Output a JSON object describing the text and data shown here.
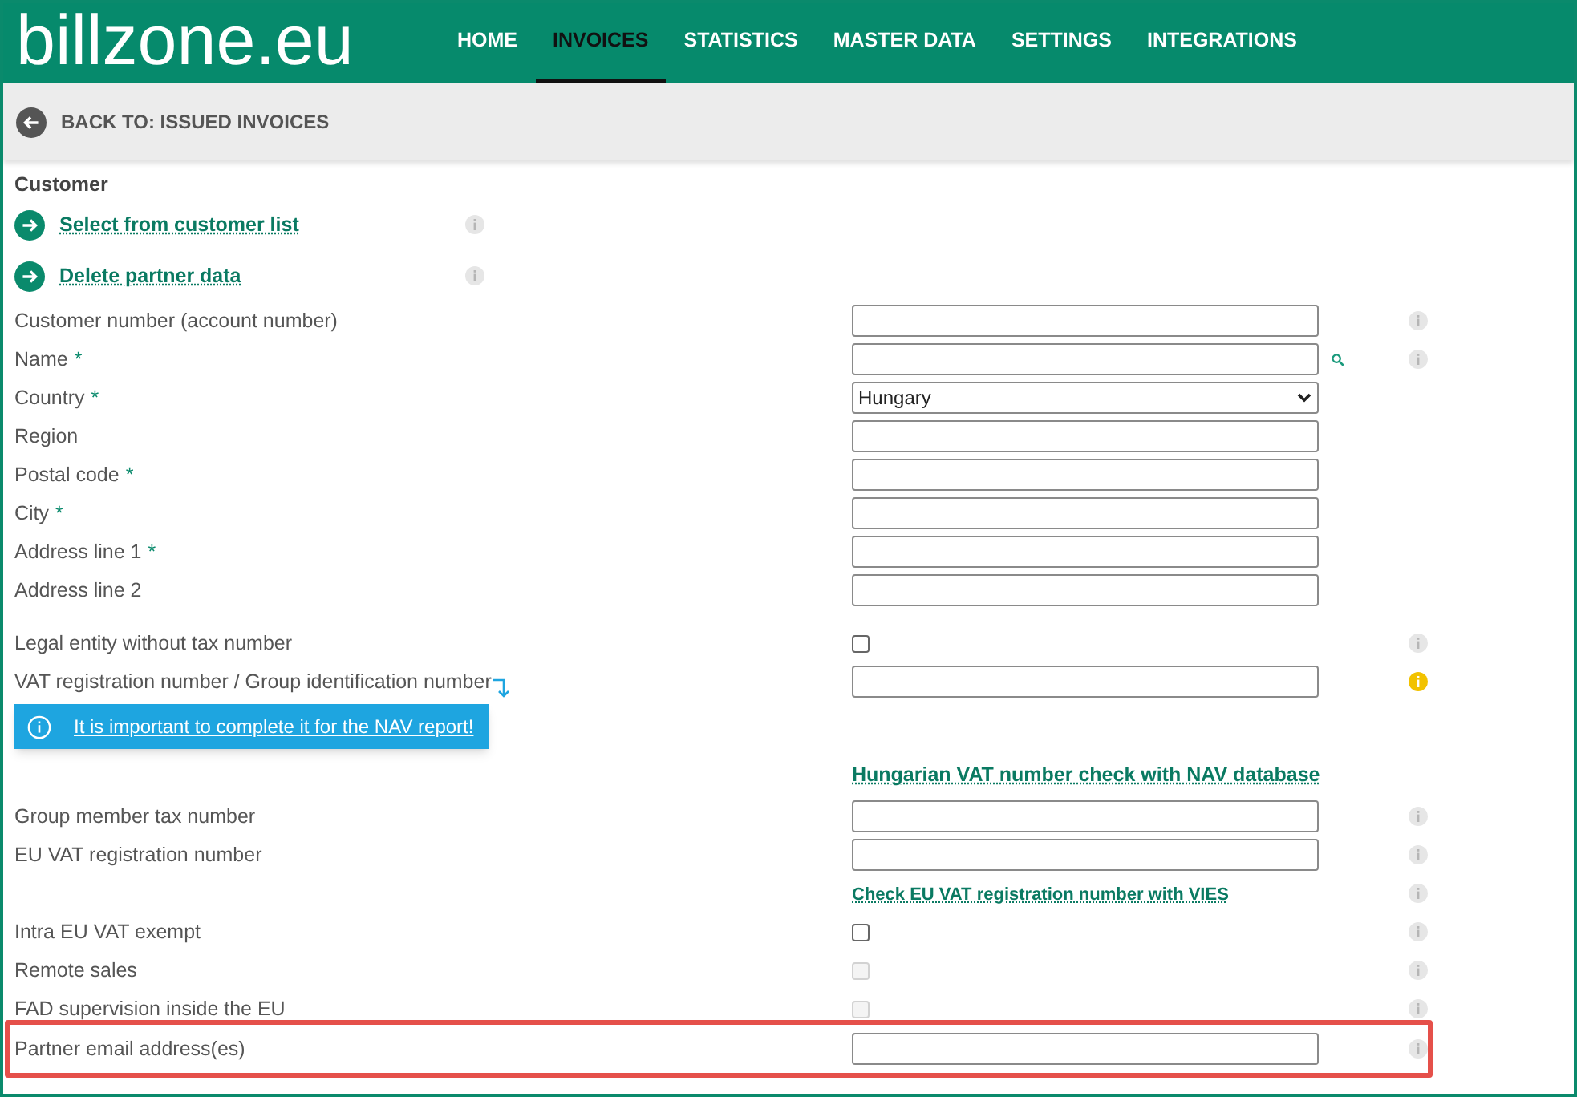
{
  "brand": {
    "logo": "billzone.eu"
  },
  "nav": [
    {
      "label": "HOME",
      "selected": false
    },
    {
      "label": "INVOICES",
      "selected": true
    },
    {
      "label": "STATISTICS",
      "selected": false
    },
    {
      "label": "MASTER DATA",
      "selected": false
    },
    {
      "label": "SETTINGS",
      "selected": false
    },
    {
      "label": "INTEGRATIONS",
      "selected": false
    }
  ],
  "back_link": "BACK TO: ISSUED INVOICES",
  "section_title": "Customer",
  "actions": [
    {
      "label": "Select from customer list",
      "info": true
    },
    {
      "label": "Delete partner data",
      "info": true
    }
  ],
  "rows": [
    {
      "kind": "text",
      "label": "Customer number (account number)",
      "info": true
    },
    {
      "kind": "text",
      "label": "Name",
      "required_mark": "*",
      "search": true,
      "info": true
    },
    {
      "kind": "select",
      "label": "Country",
      "required_mark": "*",
      "value": "Hungary"
    },
    {
      "kind": "text",
      "label": "Region"
    },
    {
      "kind": "text",
      "label": "Postal code",
      "required_mark": "*"
    },
    {
      "kind": "text",
      "label": "City",
      "required_mark": "*"
    },
    {
      "kind": "text",
      "label": "Address line 1",
      "required_mark": "*"
    },
    {
      "kind": "text",
      "label": "Address line 2"
    },
    {
      "kind": "spacer"
    },
    {
      "kind": "checkbox",
      "label": "Legal entity without tax number",
      "checked": false,
      "disabled": false,
      "info": true
    },
    {
      "kind": "text",
      "label": "VAT registration number / Group identification number",
      "hint_arrow": true,
      "info": true,
      "warning": true
    },
    {
      "kind": "notice",
      "text": "It is important to complete it for the NAV report!"
    },
    {
      "kind": "link",
      "text": "Hungarian VAT number check with NAV database"
    },
    {
      "kind": "text",
      "label": "Group member tax number",
      "info": true
    },
    {
      "kind": "text",
      "label": "EU VAT registration number",
      "info": true
    },
    {
      "kind": "small_link",
      "text": "Check EU VAT registration number with VIES",
      "info": true
    },
    {
      "kind": "checkbox",
      "label": "Intra EU VAT exempt",
      "checked": false,
      "disabled": false,
      "info": true
    },
    {
      "kind": "checkbox",
      "label": "Remote sales",
      "checked": false,
      "disabled": true,
      "info": true
    },
    {
      "kind": "checkbox",
      "label": "FAD supervision inside the EU",
      "checked": false,
      "disabled": true,
      "info": true
    },
    {
      "kind": "text",
      "label": "Partner email address(es)",
      "info": true,
      "highlighted": true
    }
  ]
}
